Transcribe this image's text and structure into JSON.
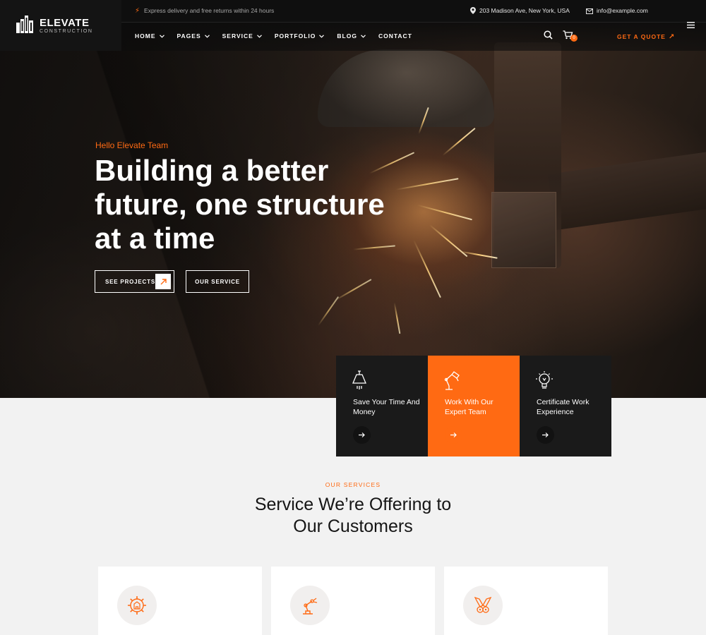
{
  "brand": {
    "name": "ELEVATE",
    "tagline": "CONSTRUCTION"
  },
  "topbar": {
    "promo": "Express delivery and free returns within 24 hours",
    "address": "203 Madison Ave, New York, USA",
    "email": "info@example.com"
  },
  "nav": {
    "items": [
      {
        "label": "HOME"
      },
      {
        "label": "PAGES"
      },
      {
        "label": "SERVICE"
      },
      {
        "label": "PORTFOLIO"
      },
      {
        "label": "BLOG"
      },
      {
        "label": "CONTACT"
      }
    ],
    "cart_count": "0",
    "quote_label": "GET A QUOTE"
  },
  "hero": {
    "eyebrow": "Hello Elevate Team",
    "headline": "Building a better future, one structure at a time",
    "primary_button": "SEE PROJECTS",
    "secondary_button": "OUR SERVICE"
  },
  "features": [
    {
      "text": "Save Your Time And Money",
      "icon": "lamp-icon"
    },
    {
      "text": "Work With Our Expert Team",
      "icon": "desk-lamp-icon"
    },
    {
      "text": "Certificate Work Experience",
      "icon": "lightbulb-icon"
    }
  ],
  "services": {
    "eyebrow": "OUR SERVICES",
    "title": "Service We’re Offering to Our Customers",
    "cards": [
      {
        "icon": "gear-building-icon"
      },
      {
        "icon": "robotic-arm-icon"
      },
      {
        "icon": "engine-pistons-icon"
      }
    ]
  },
  "colors": {
    "accent": "#ff6a13",
    "dark": "#1a1a1a",
    "light_bg": "#f2f2f2"
  }
}
